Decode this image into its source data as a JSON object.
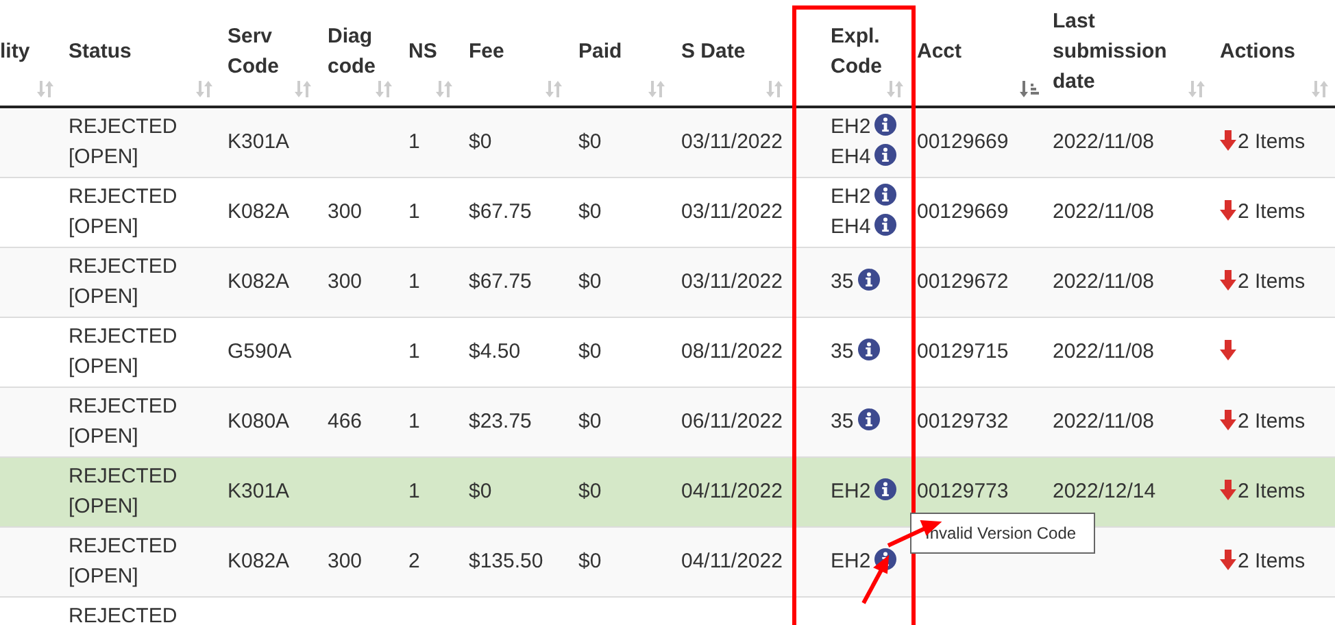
{
  "table": {
    "columns": [
      {
        "label": "lity",
        "sorted_descending": false
      },
      {
        "label": "Status",
        "sorted_descending": false
      },
      {
        "label": "Serv Code",
        "sorted_descending": false
      },
      {
        "label": "Diag code",
        "sorted_descending": false
      },
      {
        "label": "NS",
        "sorted_descending": false
      },
      {
        "label": "Fee",
        "sorted_descending": false
      },
      {
        "label": "Paid",
        "sorted_descending": false
      },
      {
        "label": "S Date",
        "sorted_descending": false
      },
      {
        "label": "Expl. Code",
        "sorted_descending": false
      },
      {
        "label": "Acct",
        "sorted_descending": true
      },
      {
        "label": "Last submission date",
        "sorted_descending": false
      },
      {
        "label": "Actions",
        "sorted_descending": false
      }
    ],
    "rows": [
      {
        "selected": false,
        "status": "REJECTED [OPEN]",
        "serv_code": "K301A",
        "ns": "1",
        "fee": "$0",
        "paid": "$0",
        "s_date": "03/11/2022",
        "expl_codes": [
          "EH2",
          "EH4"
        ],
        "acct": "00129669",
        "last_submission": "2022/11/08",
        "actions": "2 Items"
      },
      {
        "selected": false,
        "status": "REJECTED [OPEN]",
        "serv_code": "K082A",
        "diag_code": "300",
        "ns": "1",
        "fee": "$67.75",
        "paid": "$0",
        "s_date": "03/11/2022",
        "expl_codes": [
          "EH2",
          "EH4"
        ],
        "acct": "00129669",
        "last_submission": "2022/11/08",
        "actions": "2 Items"
      },
      {
        "selected": false,
        "status": "REJECTED [OPEN]",
        "serv_code": "K082A",
        "diag_code": "300",
        "ns": "1",
        "fee": "$67.75",
        "paid": "$0",
        "s_date": "03/11/2022",
        "expl_codes": [
          "35"
        ],
        "acct": "00129672",
        "last_submission": "2022/11/08",
        "actions": "2 Items"
      },
      {
        "selected": false,
        "status": "REJECTED [OPEN]",
        "serv_code": "G590A",
        "ns": "1",
        "fee": "$4.50",
        "paid": "$0",
        "s_date": "08/11/2022",
        "expl_codes": [
          "35"
        ],
        "acct": "00129715",
        "last_submission": "2022/11/08"
      },
      {
        "selected": false,
        "status": "REJECTED [OPEN]",
        "serv_code": "K080A",
        "diag_code": "466",
        "ns": "1",
        "fee": "$23.75",
        "paid": "$0",
        "s_date": "06/11/2022",
        "expl_codes": [
          "35"
        ],
        "acct": "00129732",
        "last_submission": "2022/11/08",
        "actions": "2 Items"
      },
      {
        "selected": true,
        "status": "REJECTED [OPEN]",
        "serv_code": "K301A",
        "ns": "1",
        "fee": "$0",
        "paid": "$0",
        "s_date": "04/11/2022",
        "expl_codes": [
          "EH2"
        ],
        "acct": "00129773",
        "last_submission": "2022/12/14",
        "actions": "2 Items"
      },
      {
        "selected": false,
        "status": "REJECTED [OPEN]",
        "serv_code": "K082A",
        "diag_code": "300",
        "ns": "2",
        "fee": "$135.50",
        "paid": "$0",
        "s_date": "04/11/2022",
        "expl_codes": [
          "EH2"
        ],
        "actions": "2 Items"
      },
      {
        "selected": false,
        "status": "REJECTED"
      }
    ]
  },
  "tooltip": {
    "text": "Invalid Version Code"
  }
}
